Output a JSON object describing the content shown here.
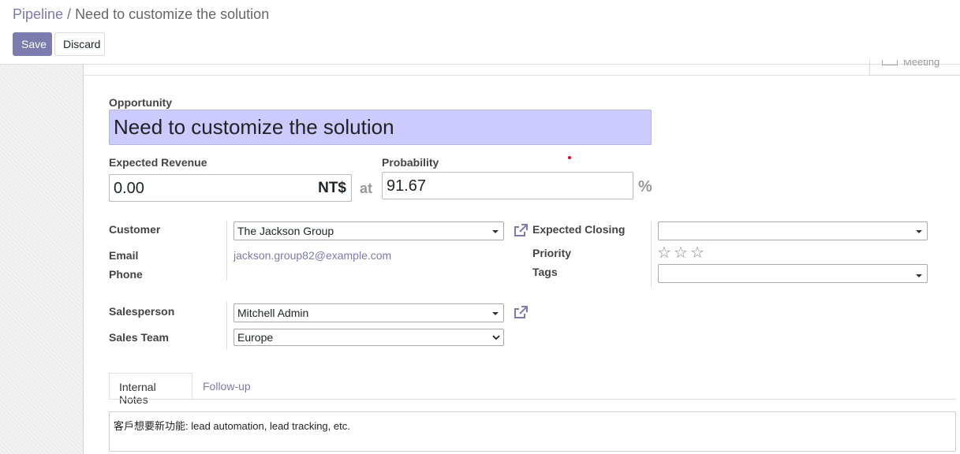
{
  "breadcrumb": {
    "parent": "Pipeline",
    "separator": "/",
    "current": "Need to customize the solution"
  },
  "actions": {
    "save_label": "Save",
    "discard_label": "Discard"
  },
  "smart_buttons": {
    "meeting_label": "Meeting"
  },
  "form": {
    "opportunity_label": "Opportunity",
    "opportunity_value": "Need to customize the solution",
    "expected_revenue_label": "Expected Revenue",
    "expected_revenue_value": "0.00",
    "currency": "NT$",
    "at_label": "at",
    "probability_label": "Probability",
    "probability_value": "91.67",
    "percent_sign": "%",
    "customer_label": "Customer",
    "customer_value": "The Jackson Group",
    "email_label": "Email",
    "email_value": "jackson.group82@example.com",
    "phone_label": "Phone",
    "phone_value": "",
    "expected_closing_label": "Expected Closing",
    "expected_closing_value": "",
    "priority_label": "Priority",
    "priority_stars_total": 3,
    "priority_stars_filled": 0,
    "tags_label": "Tags",
    "tags_value": "",
    "salesperson_label": "Salesperson",
    "salesperson_value": "Mitchell Admin",
    "sales_team_label": "Sales Team",
    "sales_team_value": "Europe"
  },
  "tabs": [
    {
      "label": "Internal Notes",
      "active": true
    },
    {
      "label": "Follow-up",
      "active": false
    }
  ],
  "notes": {
    "text": "客戶想要新功能: lead automation, lead tracking, etc."
  },
  "colors": {
    "accent": "#7c7bad",
    "title_highlight": "#cccaff",
    "required_dot": "#d0021b"
  }
}
